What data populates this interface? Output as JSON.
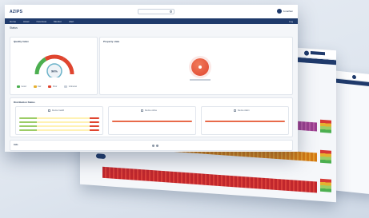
{
  "app": {
    "brand": "AZIPS",
    "user_name": "Jonathan"
  },
  "nav": {
    "items": [
      "Home",
      "Asset",
      "Overview",
      "Monitor",
      "Alert"
    ],
    "right_label": "Log"
  },
  "breadcrumb": "Status",
  "cards": {
    "gauge": {
      "title": "Quality Index",
      "value": "96%",
      "legend": [
        {
          "label": "Good",
          "color": "#4caf50"
        },
        {
          "label": "Fair",
          "color": "#e6b030"
        },
        {
          "label": "Poor",
          "color": "#e0452f"
        },
        {
          "label": "Unknown",
          "color": "#c7ced8"
        }
      ]
    },
    "status": {
      "title": "Property state"
    },
    "distribution": {
      "title": "Distribution Status",
      "panels": [
        {
          "header": "Device health"
        },
        {
          "header": "Device online"
        },
        {
          "header": "Device Alarm"
        }
      ]
    },
    "footer": {
      "title": "Info"
    }
  },
  "colors": {
    "navy": "#1f3a6b",
    "green": "#4caf50",
    "amber": "#e6b030",
    "red": "#e0452f"
  }
}
